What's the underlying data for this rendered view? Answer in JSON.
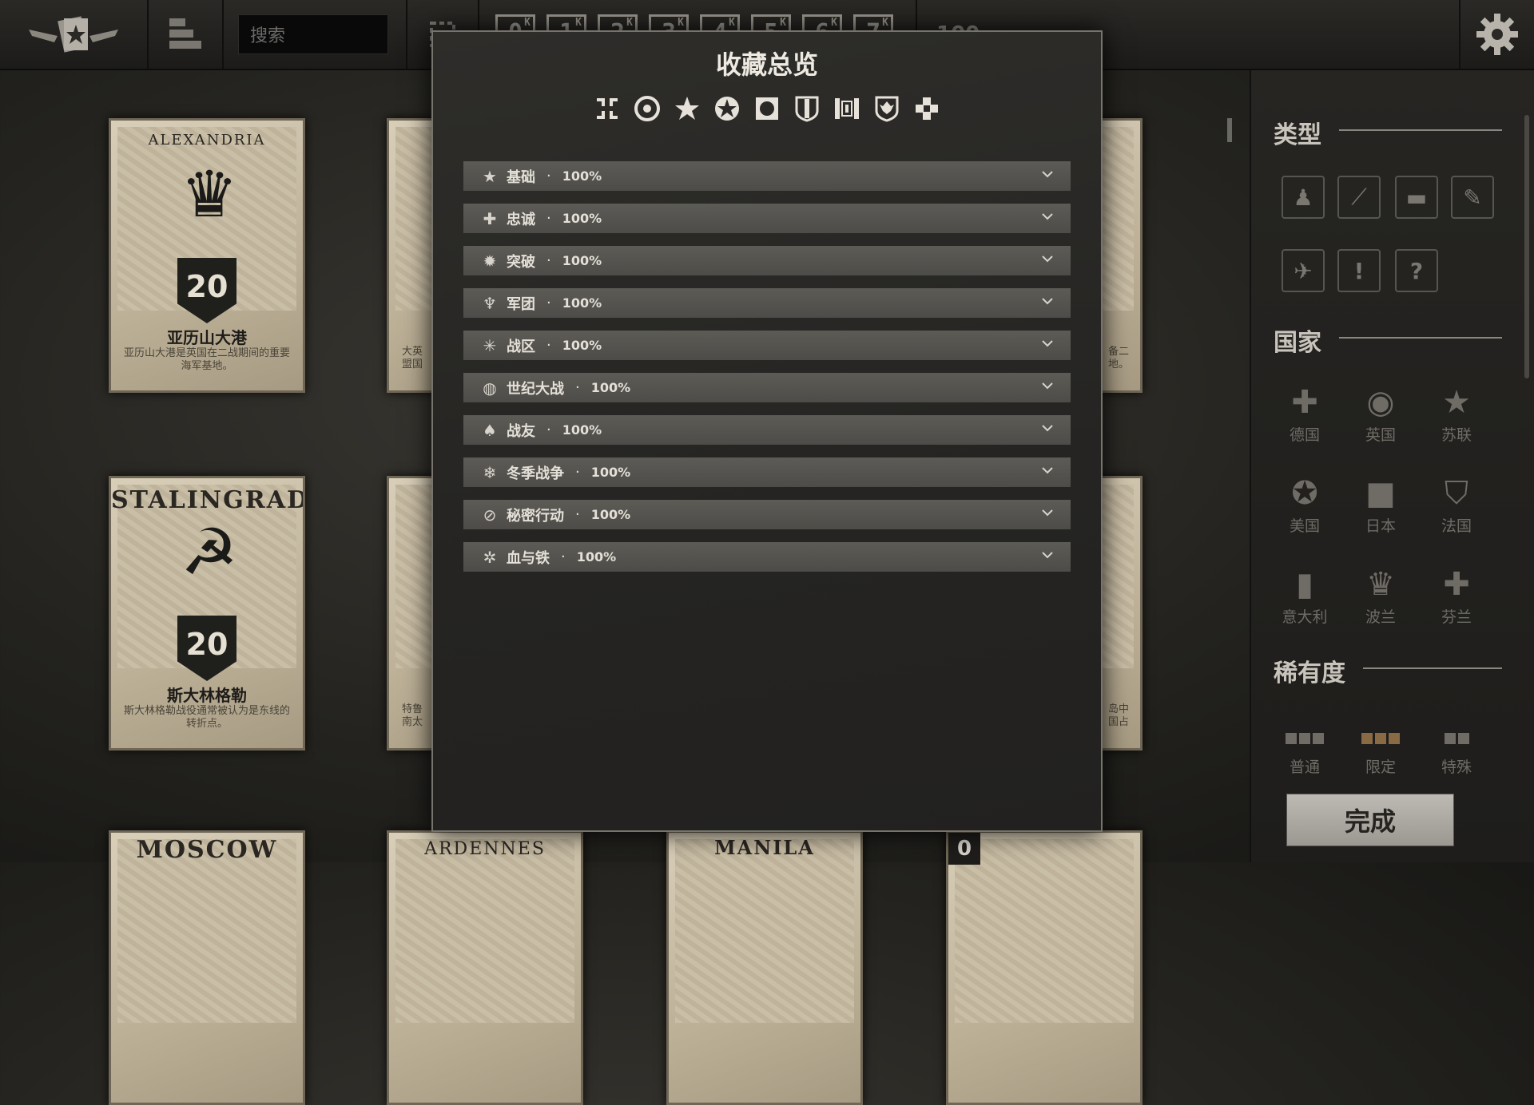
{
  "topbar": {
    "search_placeholder": "搜索",
    "costs": [
      "0",
      "1",
      "2",
      "3",
      "4",
      "5",
      "6",
      "7"
    ],
    "cost_suffix": "K",
    "credits_partial": "100"
  },
  "cards": [
    {
      "city": "ALEXANDRIA",
      "value": "20",
      "name": "亚历山大港",
      "desc": "亚历山大港是英国在二战期间的重要海军基地。"
    },
    {
      "city": "STALINGRAD",
      "value": "20",
      "name": "斯大林格勒",
      "desc": "斯大林格勒战役通常被认为是东线的转折点。"
    },
    {
      "partial_desc_1": "大英",
      "partial_desc_2": "盟国",
      "partial_desc_3": "特鲁",
      "partial_desc_4": "南太"
    },
    {
      "partial_right_1": "备二",
      "partial_right_2": "地。",
      "partial_right_3": "岛中",
      "partial_right_4": "国占"
    },
    {
      "city_bottom_1": "MOSCOW",
      "city_bottom_2": "ARDENNES",
      "city_bottom_3": "MANILA",
      "cost_bottom": "0"
    }
  ],
  "modal": {
    "title": "收藏总览",
    "nations": [
      "german-cross",
      "uk-roundel",
      "soviet-star",
      "us-star",
      "japan-disc",
      "france-shield",
      "italy-flag",
      "poland-eagle",
      "finland-cross"
    ],
    "rows": [
      {
        "icon": "★",
        "name": "基础",
        "pct": "100%"
      },
      {
        "icon": "✚",
        "name": "忠诚",
        "pct": "100%"
      },
      {
        "icon": "✹",
        "name": "突破",
        "pct": "100%"
      },
      {
        "icon": "♆",
        "name": "军团",
        "pct": "100%"
      },
      {
        "icon": "✳",
        "name": "战区",
        "pct": "100%"
      },
      {
        "icon": "◍",
        "name": "世纪大战",
        "pct": "100%"
      },
      {
        "icon": "♠",
        "name": "战友",
        "pct": "100%"
      },
      {
        "icon": "❄",
        "name": "冬季战争",
        "pct": "100%"
      },
      {
        "icon": "⊘",
        "name": "秘密行动",
        "pct": "100%"
      },
      {
        "icon": "✲",
        "name": "血与铁",
        "pct": "100%"
      }
    ],
    "separator": "·"
  },
  "sidebar": {
    "type_heading": "类型",
    "type_icons": [
      "infantry-icon",
      "artillery-icon",
      "tank-icon",
      "bomber-icon",
      "fighter-icon",
      "order-icon",
      "countermeasure-icon"
    ],
    "nation_heading": "国家",
    "nations": [
      {
        "icon": "✚",
        "label": "德国"
      },
      {
        "icon": "◉",
        "label": "英国"
      },
      {
        "icon": "★",
        "label": "苏联"
      },
      {
        "icon": "✪",
        "label": "美国"
      },
      {
        "icon": "■",
        "label": "日本"
      },
      {
        "icon": "⛉",
        "label": "法国"
      },
      {
        "icon": "▮",
        "label": "意大利"
      },
      {
        "icon": "♛",
        "label": "波兰"
      },
      {
        "icon": "✚",
        "label": "芬兰"
      }
    ],
    "rarity_heading": "稀有度",
    "rarities": [
      {
        "label": "普通",
        "color": "#6f6c66"
      },
      {
        "label": "限定",
        "color": "#8a6a44"
      },
      {
        "label": "特殊",
        "color": "#6f6c66"
      }
    ],
    "done_label": "完成"
  }
}
